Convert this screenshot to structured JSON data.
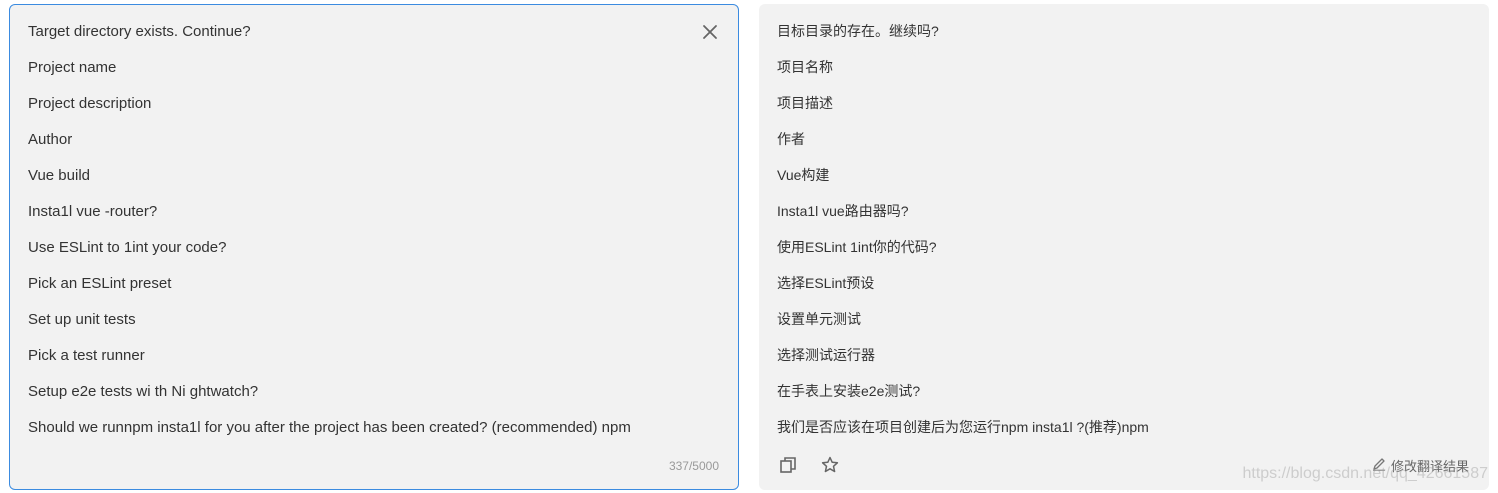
{
  "source": {
    "lines": [
      "Target directory exists. Continue?",
      "Project name",
      "Project description",
      "Author",
      "Vue build",
      "Insta1l vue -router?",
      "Use ESLint to 1int your code?",
      "Pick an ESLint preset",
      "Set up unit tests",
      "Pick a test runner",
      "Setup e2e tests wi th Ni ghtwatch?",
      "Should we runnpm insta1l for you after the project has been created? (recommended) npm"
    ],
    "char_count": "337/5000",
    "close_icon": "close-icon"
  },
  "target": {
    "lines": [
      "目标目录的存在。继续吗?",
      "项目名称",
      "项目描述",
      "作者",
      "Vue构建",
      "Insta1l vue路由器吗?",
      "使用ESLint 1int你的代码?",
      "选择ESLint预设",
      "设置单元测试",
      "选择测试运行器",
      "在手表上安装e2e测试?",
      "我们是否应该在项目创建后为您运行npm insta1l ?(推荐)npm"
    ],
    "edit_label": "修改翻译结果",
    "copy_icon": "copy-icon",
    "star_icon": "star-icon",
    "pencil_icon": "pencil-icon"
  },
  "watermark": "https://blog.csdn.net/qq_42661587",
  "colors": {
    "accent": "#3b8be0",
    "panel_bg": "#f2f2f2"
  }
}
